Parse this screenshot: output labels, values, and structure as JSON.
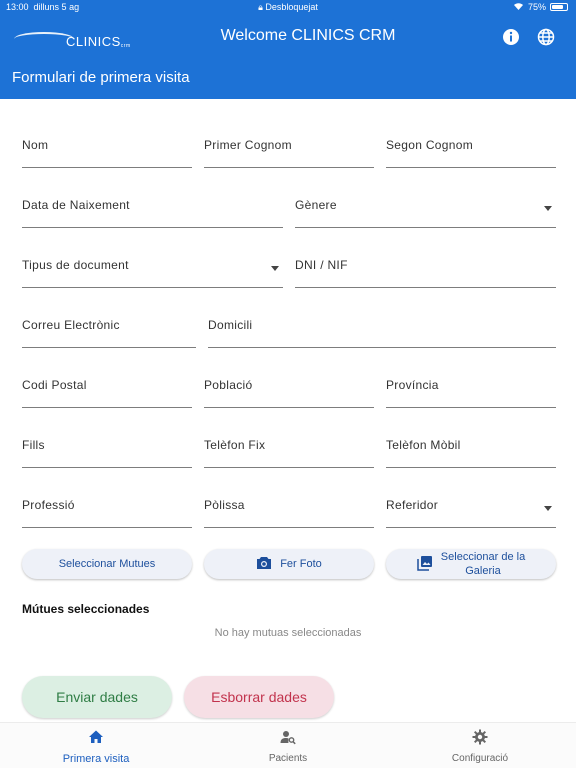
{
  "status_bar": {
    "time": "13:00",
    "date": "dilluns 5 ag",
    "lock_text": "Desbloquejat",
    "battery": "75%",
    "battery_level": 0.75
  },
  "header": {
    "logo_text": "CLINICS",
    "logo_tm": "crm",
    "title": "Welcome CLINICS CRM",
    "page_title": "Formulari de primera visita"
  },
  "form": {
    "nom": "Nom",
    "primer_cognom": "Primer Cognom",
    "segon_cognom": "Segon Cognom",
    "data_naixement": "Data de Naixement",
    "genere": "Gènere",
    "tipus_document": "Tipus de document",
    "dni": "DNI / NIF",
    "correu": "Correu Electrònic",
    "domicili": "Domicili",
    "codi_postal": "Codi Postal",
    "poblacio": "Població",
    "provincia": "Província",
    "fills": "Fills",
    "telefon_fix": "Telèfon Fix",
    "telefon_mobil": "Telèfon Mòbil",
    "professio": "Professió",
    "polissa": "Pòlissa",
    "referidor": "Referidor"
  },
  "actions": {
    "select_mutues": "Seleccionar Mutues",
    "take_photo": "Fer Foto",
    "gallery_line1": "Seleccionar de la",
    "gallery_line2": "Galeria"
  },
  "mutues": {
    "title": "Mútues seleccionades",
    "empty": "No hay mutuas seleccionadas"
  },
  "buttons": {
    "send": "Enviar dades",
    "clear": "Esborrar dades"
  },
  "nav": {
    "first_visit": "Primera visita",
    "patients": "Pacients",
    "config": "Configuració"
  },
  "colors": {
    "primary": "#1d72d6",
    "send_bg": "#dcefe3",
    "clear_bg": "#f6dfe5"
  }
}
